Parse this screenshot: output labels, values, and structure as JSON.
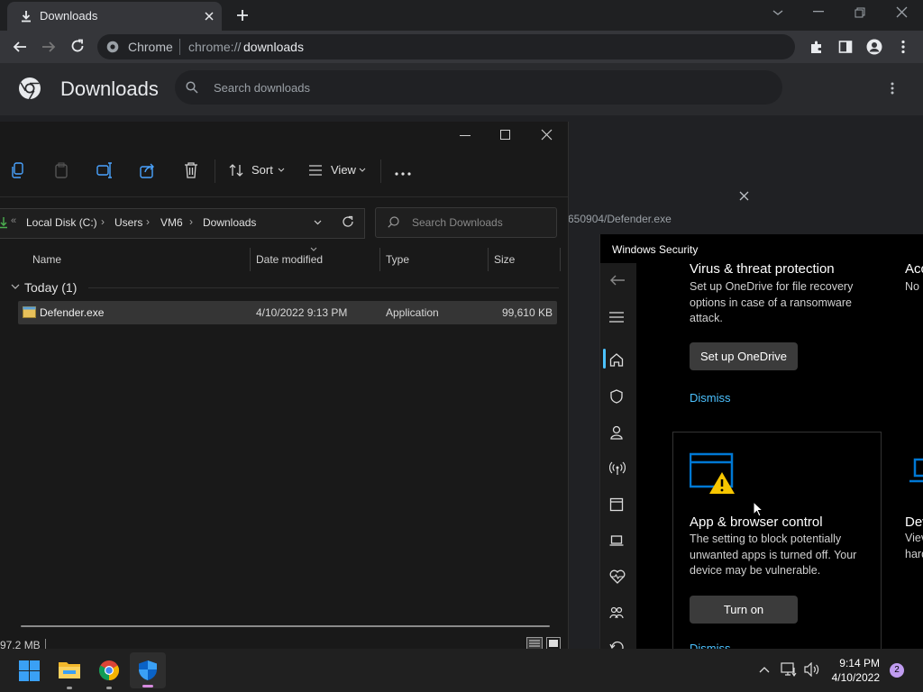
{
  "chrome": {
    "tab_title": "Downloads",
    "omnibox": {
      "site_label": "Chrome",
      "url_prefix": "chrome://",
      "url_path": "downloads"
    },
    "page_title": "Downloads",
    "search_placeholder": "Search downloads",
    "download_path_fragment": "650904/Defender.exe"
  },
  "explorer": {
    "commands": {
      "sort": "Sort",
      "view": "View"
    },
    "breadcrumb": [
      "Local Disk (C:)",
      "Users",
      "VM6",
      "Downloads"
    ],
    "search_placeholder": "Search Downloads",
    "columns": [
      "Name",
      "Date modified",
      "Type",
      "Size"
    ],
    "group": "Today (1)",
    "file": {
      "name": "Defender.exe",
      "date": "4/10/2022 9:13 PM",
      "type": "Application",
      "size": "99,610 KB"
    },
    "status": "97.2 MB"
  },
  "security": {
    "window_title": "Windows Security",
    "virus": {
      "title": "Virus & threat protection",
      "desc": "Set up OneDrive for file recovery options in case of a ransomware attack.",
      "button": "Set up OneDrive",
      "dismiss": "Dismiss"
    },
    "account": {
      "title_partial": "Acc",
      "desc_partial": "No"
    },
    "app": {
      "title": "App & browser control",
      "desc": "The setting to block potentially unwanted apps is turned off. Your device may be vulnerable.",
      "button": "Turn on",
      "dismiss": "Dismiss"
    },
    "device": {
      "title_partial": "Dev",
      "line1": "Viev",
      "line2": "hard"
    }
  },
  "taskbar": {
    "time": "9:14 PM",
    "date": "4/10/2022",
    "notification_count": "2"
  },
  "colors": {
    "accent": "#0078d4",
    "link": "#4cc2ff",
    "warning": "#f7c600"
  }
}
